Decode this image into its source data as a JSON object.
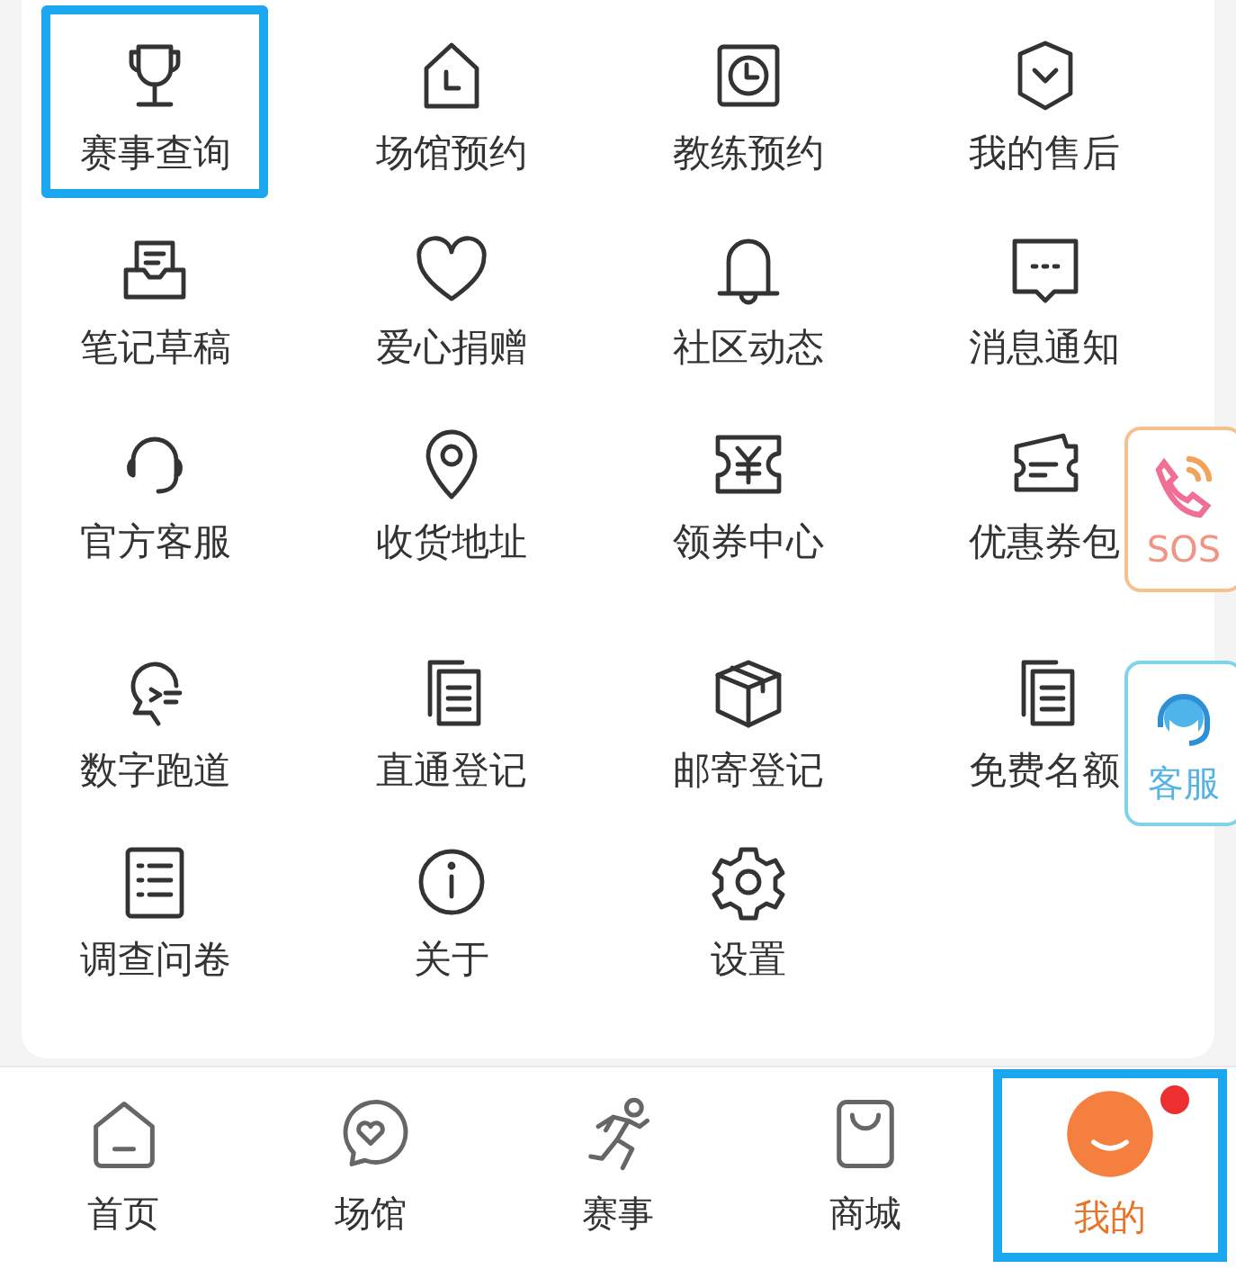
{
  "menu": {
    "items": [
      {
        "label": "赛事查询",
        "highlighted": true
      },
      {
        "label": "场馆预约",
        "highlighted": false
      },
      {
        "label": "教练预约",
        "highlighted": false
      },
      {
        "label": "我的售后",
        "highlighted": false
      },
      {
        "label": "笔记草稿",
        "highlighted": false
      },
      {
        "label": "爱心捐赠",
        "highlighted": false
      },
      {
        "label": "社区动态",
        "highlighted": false
      },
      {
        "label": "消息通知",
        "highlighted": false
      },
      {
        "label": "官方客服",
        "highlighted": false
      },
      {
        "label": "收货地址",
        "highlighted": false
      },
      {
        "label": "领券中心",
        "highlighted": false
      },
      {
        "label": "优惠券包",
        "highlighted": false
      },
      {
        "label": "数字跑道",
        "highlighted": false
      },
      {
        "label": "直通登记",
        "highlighted": false
      },
      {
        "label": "邮寄登记",
        "highlighted": false
      },
      {
        "label": "免费名额",
        "highlighted": false
      },
      {
        "label": "调查问卷",
        "highlighted": false
      },
      {
        "label": "关于",
        "highlighted": false
      },
      {
        "label": "设置",
        "highlighted": false
      }
    ]
  },
  "floating_buttons": [
    {
      "label": "SOS",
      "kind": "sos"
    },
    {
      "label": "客服",
      "kind": "service"
    }
  ],
  "tab_bar": {
    "tabs": [
      {
        "label": "首页",
        "selected": false,
        "highlighted": false,
        "badge": false
      },
      {
        "label": "场馆",
        "selected": false,
        "highlighted": false,
        "badge": false
      },
      {
        "label": "赛事",
        "selected": false,
        "highlighted": false,
        "badge": false
      },
      {
        "label": "商城",
        "selected": false,
        "highlighted": false,
        "badge": false
      },
      {
        "label": "我的",
        "selected": true,
        "highlighted": true,
        "badge": true
      }
    ]
  }
}
